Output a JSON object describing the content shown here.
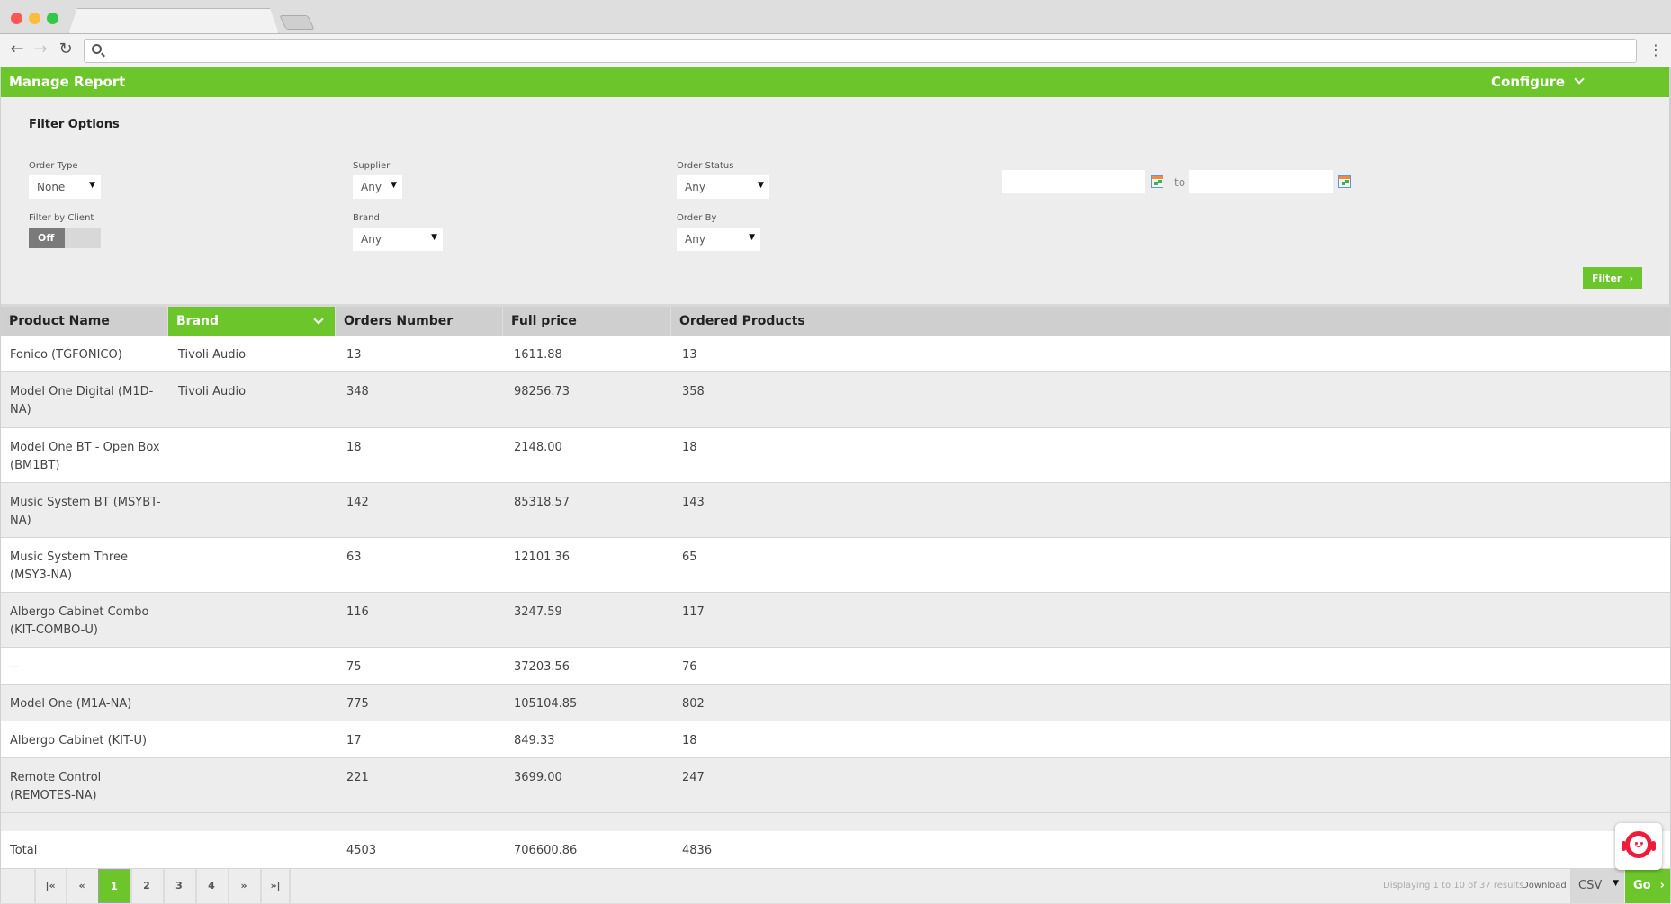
{
  "browser": {
    "tab_title": "",
    "address": "",
    "icons": {
      "back": "arrow-left-icon",
      "forward": "arrow-right-icon",
      "reload": "reload-icon",
      "search": "search-icon",
      "menu": "kebab-menu-icon"
    }
  },
  "app": {
    "title": "Manage Report",
    "configure_label": "Configure",
    "accent_color": "#6cc62b"
  },
  "filters": {
    "title": "Filter Options",
    "order_type": {
      "label": "Order Type",
      "value": "None"
    },
    "supplier": {
      "label": "Supplier",
      "value": "Any"
    },
    "order_status": {
      "label": "Order Status",
      "value": "Any"
    },
    "filter_by_client": {
      "label": "Filter by Client",
      "value": "Off"
    },
    "brand": {
      "label": "Brand",
      "value": "Any"
    },
    "order_by": {
      "label": "Order By",
      "value": "Any"
    },
    "date_from": "",
    "date_to": "",
    "to_label": "to",
    "filter_button": "Filter"
  },
  "table": {
    "columns": [
      "Product Name",
      "Brand",
      "Orders Number",
      "Full price",
      "Ordered Products"
    ],
    "sorted_column": "Brand",
    "rows": [
      {
        "name": "Fonico (TGFONICO)",
        "brand": "Tivoli Audio",
        "orders": "13",
        "price": "1611.88",
        "ordered": "13"
      },
      {
        "name": "Model One Digital (M1D-NA)",
        "brand": "Tivoli Audio",
        "orders": "348",
        "price": "98256.73",
        "ordered": "358"
      },
      {
        "name": "Model One BT - Open Box (BM1BT)",
        "brand": "",
        "orders": "18",
        "price": "2148.00",
        "ordered": "18"
      },
      {
        "name": "Music System BT (MSYBT-NA)",
        "brand": "",
        "orders": "142",
        "price": "85318.57",
        "ordered": "143"
      },
      {
        "name": "Music System Three (MSY3-NA)",
        "brand": "",
        "orders": "63",
        "price": "12101.36",
        "ordered": "65"
      },
      {
        "name": "Albergo Cabinet Combo (KIT-COMBO-U)",
        "brand": "",
        "orders": "116",
        "price": "3247.59",
        "ordered": "117"
      },
      {
        "name": "--",
        "brand": "",
        "orders": "75",
        "price": "37203.56",
        "ordered": "76"
      },
      {
        "name": "Model One (M1A-NA)",
        "brand": "",
        "orders": "775",
        "price": "105104.85",
        "ordered": "802"
      },
      {
        "name": "Albergo Cabinet (KIT-U)",
        "brand": "",
        "orders": "17",
        "price": "849.33",
        "ordered": "18"
      },
      {
        "name": "Remote Control (REMOTES-NA)",
        "brand": "",
        "orders": "221",
        "price": "3699.00",
        "ordered": "247"
      }
    ],
    "total": {
      "label": "Total",
      "orders": "4503",
      "price": "706600.86",
      "ordered": "4836"
    }
  },
  "pagination": {
    "first": "|«",
    "prev": "«",
    "pages": [
      "1",
      "2",
      "3",
      "4"
    ],
    "current": "1",
    "next": "»",
    "last": "»|",
    "results_text": "Displaying 1 to 10 of 37 results",
    "download_label": "Download",
    "format": "CSV",
    "go_label": "Go"
  },
  "chat_widget": {
    "icon": "support-chat-icon"
  }
}
